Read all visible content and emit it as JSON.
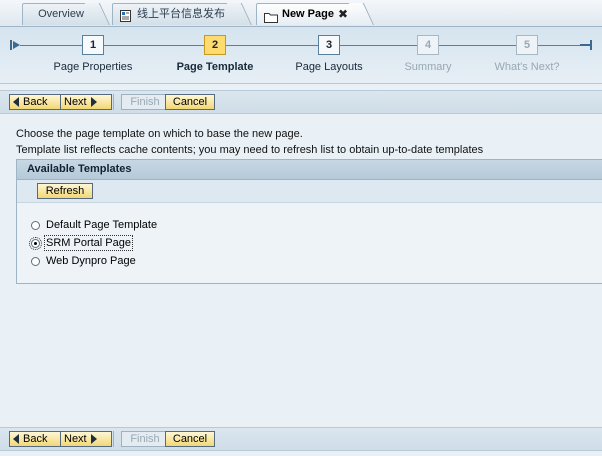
{
  "tabs": {
    "overview": "Overview",
    "portal_publish": "线上平台信息发布",
    "new_page": "New Page",
    "new_page_close": "✖"
  },
  "roadmap": {
    "steps": [
      {
        "number": "1",
        "label": "Page Properties",
        "state": "done"
      },
      {
        "number": "2",
        "label": "Page Template",
        "state": "current"
      },
      {
        "number": "3",
        "label": "Page Layouts",
        "state": "enabled"
      },
      {
        "number": "4",
        "label": "Summary",
        "state": "disabled"
      },
      {
        "number": "5",
        "label": "What's Next?",
        "state": "disabled"
      }
    ]
  },
  "toolbar": {
    "back": "Back",
    "next": "Next",
    "finish": "Finish",
    "cancel": "Cancel"
  },
  "content": {
    "line1": "Choose the page template on which to base the new page.",
    "line2": "Template list reflects cache contents; you may need to refresh list to obtain up-to-date templates"
  },
  "templates_panel": {
    "header": "Available Templates",
    "refresh": "Refresh",
    "options": [
      {
        "label": "Default Page Template",
        "checked": false
      },
      {
        "label": "SRM Portal Page",
        "checked": true
      },
      {
        "label": "Web Dynpro Page",
        "checked": false
      }
    ]
  },
  "colors": {
    "accent_button": "#f3d774",
    "current_step": "#fddb6e",
    "panel_header": "#b5c9d8",
    "background": "#eaf1f6"
  }
}
